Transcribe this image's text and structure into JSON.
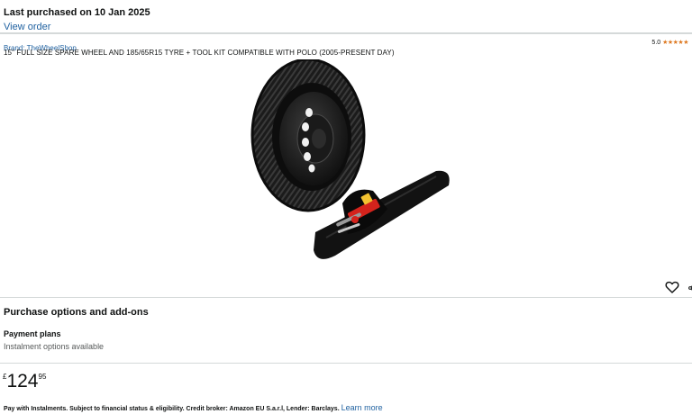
{
  "banner": {
    "title": "Last purchased on 10 Jan 2025",
    "link": "View order"
  },
  "product": {
    "brand": "Brand: TheWheelShop",
    "rating_value": "5.0",
    "rating_stars": "★★★★★",
    "title": "15\" FULL SIZE SPARE WHEEL AND 185/65R15 TYRE + TOOL KIT COMPATIBLE WITH POLO (2005-PRESENT DAY)"
  },
  "icons": {
    "heart": "heart-icon",
    "share": "share-icon"
  },
  "purchase": {
    "section_title": "Purchase options and add-ons",
    "payment_title": "Payment plans",
    "payment_sub": "Instalment options available"
  },
  "price": {
    "symbol": "£",
    "whole": "124",
    "fraction": "95"
  },
  "instalments": {
    "text": "Pay with Instalments. Subject to financial status & eligibility. Credit broker: Amazon EU S.a.r.l, Lender: Barclays.",
    "link": "Learn more"
  },
  "colors": {
    "link": "#2162a1",
    "star": "#de7921",
    "divider": "#d5d9d9",
    "text": "#0f1111",
    "muted": "#565959"
  }
}
